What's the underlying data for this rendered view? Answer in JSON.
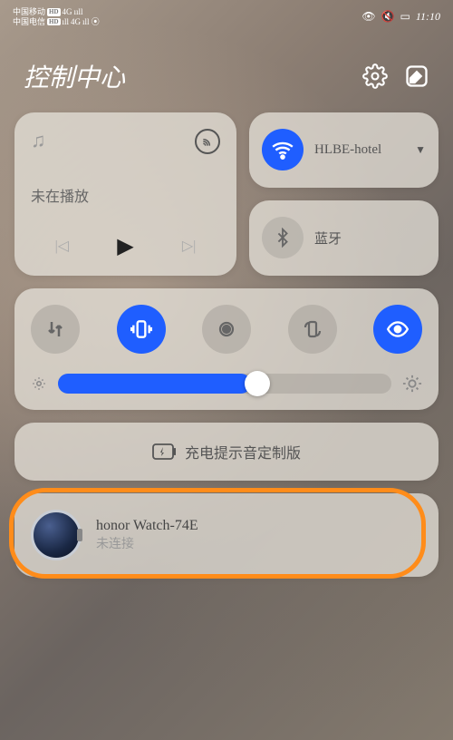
{
  "status": {
    "carrier1": "中国移动",
    "carrier2": "中国电信",
    "signal_type": "4G",
    "time": "11:10",
    "battery_icon": "battery-7"
  },
  "header": {
    "title": "控制中心"
  },
  "music": {
    "status_text": "未在播放"
  },
  "wifi": {
    "label": "HLBE-hotel",
    "active": true
  },
  "bluetooth": {
    "label": "蓝牙",
    "active": false
  },
  "toggles": {
    "data": false,
    "vibrate": true,
    "hotspot": false,
    "rotate": false,
    "eye_comfort": true
  },
  "brightness": {
    "percent": 58
  },
  "charge_tile": {
    "label": "充电提示音定制版"
  },
  "device": {
    "name": "honor Watch-74E",
    "status": "未连接"
  }
}
